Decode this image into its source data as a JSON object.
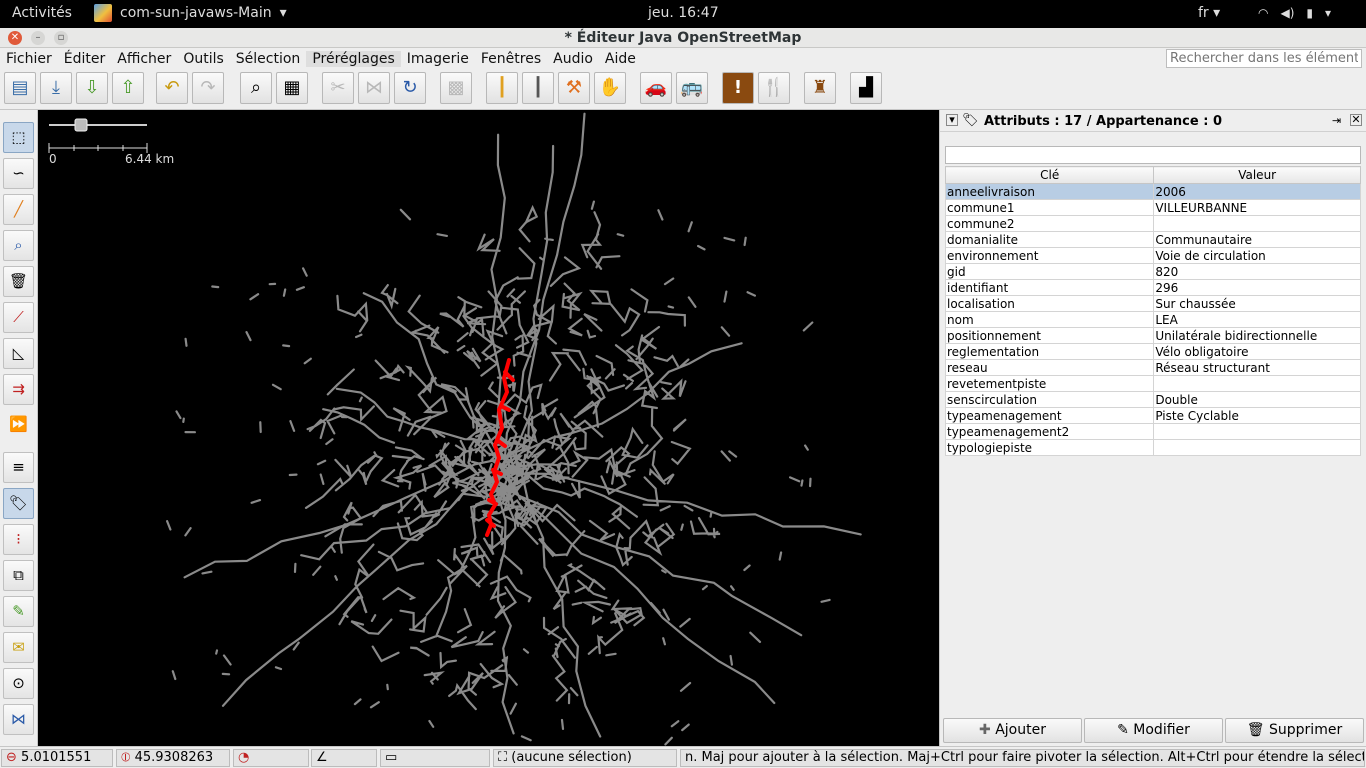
{
  "topbar": {
    "activities": "Activités",
    "app_name": "com-sun-javaws-Main",
    "clock": "jeu. 16:47",
    "lang": "fr"
  },
  "window": {
    "title": "* Éditeur Java OpenStreetMap"
  },
  "menu": [
    "Fichier",
    "Éditer",
    "Afficher",
    "Outils",
    "Sélection",
    "Préréglages",
    "Imagerie",
    "Fenêtres",
    "Audio",
    "Aide"
  ],
  "search": {
    "placeholder": "Rechercher dans les éléments"
  },
  "map": {
    "scale_start": "0",
    "scale_end": "6.44 km",
    "colors": {
      "ways": "#8a8a8a",
      "selected": "#ff0000"
    }
  },
  "panel": {
    "title": "Attributs : 17 / Appartenance : 0",
    "col_key": "Clé",
    "col_value": "Valeur",
    "rows": [
      {
        "k": "anneelivraison",
        "v": "2006"
      },
      {
        "k": "commune1",
        "v": "VILLEURBANNE"
      },
      {
        "k": "commune2",
        "v": ""
      },
      {
        "k": "domanialite",
        "v": "Communautaire"
      },
      {
        "k": "environnement",
        "v": "Voie de circulation"
      },
      {
        "k": "gid",
        "v": "820"
      },
      {
        "k": "identifiant",
        "v": "296"
      },
      {
        "k": "localisation",
        "v": "Sur chaussée"
      },
      {
        "k": "nom",
        "v": "LEA"
      },
      {
        "k": "positionnement",
        "v": "Unilatérale bidirectionnelle"
      },
      {
        "k": "reglementation",
        "v": "Vélo obligatoire"
      },
      {
        "k": "reseau",
        "v": "Réseau structurant"
      },
      {
        "k": "revetementpiste",
        "v": ""
      },
      {
        "k": "senscirculation",
        "v": "Double"
      },
      {
        "k": "typeamenagement",
        "v": "Piste Cyclable"
      },
      {
        "k": "typeamenagement2",
        "v": ""
      },
      {
        "k": "typologiepiste",
        "v": ""
      }
    ],
    "buttons": {
      "add": "Ajouter",
      "edit": "Modifier",
      "delete": "Supprimer"
    }
  },
  "status": {
    "lon": "5.0101551",
    "lat": "45.9308263",
    "selection": "(aucune sélection)",
    "help": "n. Maj pour ajouter à la sélection. Maj+Ctrl pour faire pivoter la sélection. Alt+Ctrl pour étendre la sélection."
  }
}
